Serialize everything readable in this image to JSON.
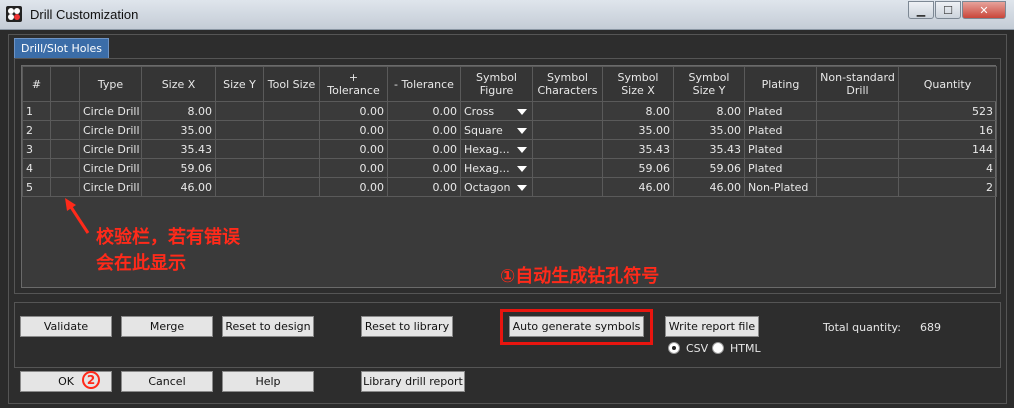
{
  "window": {
    "title": "Drill Customization"
  },
  "tabs": [
    "Drill/Slot Holes"
  ],
  "table": {
    "headers": [
      "#",
      "",
      "Type",
      "Size X",
      "Size Y",
      "Tool Size",
      "+ Tolerance",
      "- Tolerance",
      "Symbol Figure",
      "Symbol Characters",
      "Symbol Size X",
      "Symbol Size Y",
      "Plating",
      "Non-standard Drill",
      "Quantity"
    ],
    "rows": [
      {
        "num": "1",
        "type": "Circle Drill",
        "size_x": "8.00",
        "plus_tol": "0.00",
        "minus_tol": "0.00",
        "figure": "Cross",
        "sym_x": "8.00",
        "sym_y": "8.00",
        "plating": "Plated",
        "quantity": "523"
      },
      {
        "num": "2",
        "type": "Circle Drill",
        "size_x": "35.00",
        "plus_tol": "0.00",
        "minus_tol": "0.00",
        "figure": "Square",
        "sym_x": "35.00",
        "sym_y": "35.00",
        "plating": "Plated",
        "quantity": "16"
      },
      {
        "num": "3",
        "type": "Circle Drill",
        "size_x": "35.43",
        "plus_tol": "0.00",
        "minus_tol": "0.00",
        "figure": "Hexag...",
        "sym_x": "35.43",
        "sym_y": "35.43",
        "plating": "Plated",
        "quantity": "144"
      },
      {
        "num": "4",
        "type": "Circle Drill",
        "size_x": "59.06",
        "plus_tol": "0.00",
        "minus_tol": "0.00",
        "figure": "Hexag...",
        "sym_x": "59.06",
        "sym_y": "59.06",
        "plating": "Plated",
        "quantity": "4"
      },
      {
        "num": "5",
        "type": "Circle Drill",
        "size_x": "46.00",
        "plus_tol": "0.00",
        "minus_tol": "0.00",
        "figure": "Octagon",
        "sym_x": "46.00",
        "sym_y": "46.00",
        "plating": "Non-Plated",
        "quantity": "2"
      }
    ]
  },
  "annotations": {
    "check_note": "校验栏，若有错误\n会在此显示",
    "auto_note": "①自动生成钻孔符号",
    "step_two": "2"
  },
  "buttons": {
    "validate": "Validate",
    "merge": "Merge",
    "reset_design": "Reset to design",
    "reset_library": "Reset to library",
    "auto_generate": "Auto generate symbols",
    "write_report": "Write report file",
    "ok": "OK",
    "cancel": "Cancel",
    "help": "Help",
    "library_report": "Library drill report"
  },
  "report_format": {
    "options": [
      "CSV",
      "HTML"
    ],
    "selected": "CSV"
  },
  "total": {
    "label": "Total quantity:",
    "value": "689"
  },
  "colors": {
    "accent_blue": "#3f8fe0",
    "annotation_red": "#ff2a1a",
    "tab_blue": "#3b6da8"
  }
}
